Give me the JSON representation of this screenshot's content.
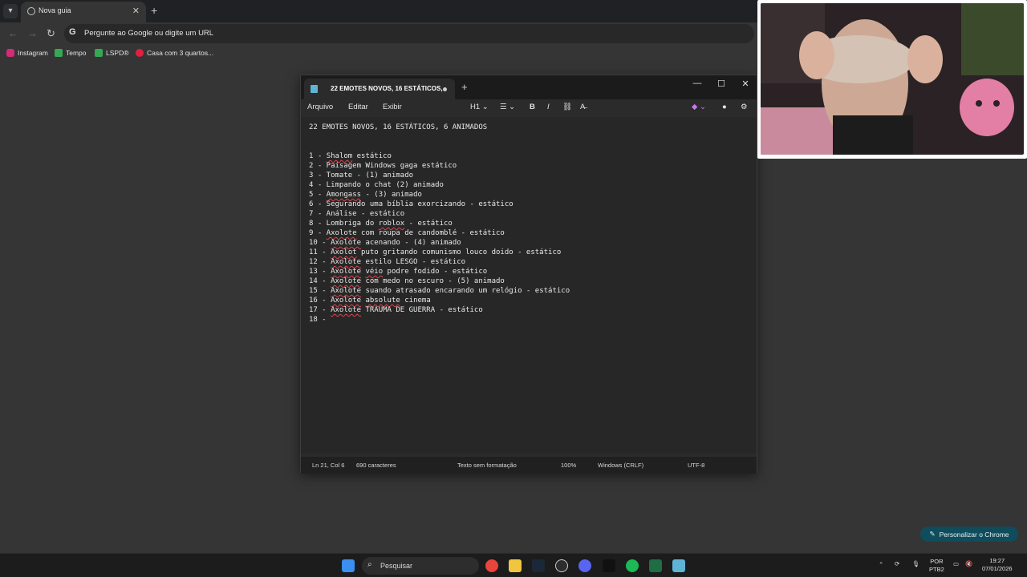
{
  "browser": {
    "tab_title": "Nova guia",
    "omnibox_placeholder": "Pergunte ao Google ou digite um URL",
    "bookmarks": [
      {
        "label": "Instagram",
        "color": "#d62976"
      },
      {
        "label": "Tempo",
        "color": "#34a853"
      },
      {
        "label": "LSPD®",
        "color": "#34a853"
      },
      {
        "label": "Casa com 3 quartos...",
        "color": "#e02040"
      }
    ],
    "customize_label": "Personalizar o Chrome"
  },
  "notepad": {
    "tab_title": "22 EMOTES NOVOS, 16 ESTÁTICOS,",
    "menu": [
      "Arquivo",
      "Editar",
      "Exibir"
    ],
    "heading_menu": "H1",
    "lines": [
      "22 EMOTES NOVOS, 16 ESTÁTICOS, 6 ANIMADOS",
      "",
      "",
      "1 - Shalom estático",
      "2 - Paisagem Windows gaga estático",
      "3 - Tomate - (1) animado",
      "4 - Limpando o chat (2) animado",
      "5 - Amongass - (3) animado",
      "6 - Segurando uma bíblia exorcizando - estático",
      "7 - Análise - estático",
      "8 - Lombriga do roblox - estático",
      "9 - Axolote com roupa de candomblé - estático",
      "10 - Axolote acenando - (4) animado",
      "11 - Axolot puto gritando comunismo louco doido - estático",
      "12 - Axolote estilo LESGO - estático",
      "13 - Axolote véio podre fodido - estático",
      "14 - Axolote com medo no escuro - (5) animado",
      "15 - Axolote suando atrasado encarando um relógio - estático",
      "16 - Axolote absolute cinema",
      "17 - Axolote TRAUMA DE GUERRA - estático",
      "18 - "
    ],
    "status": {
      "position": "Ln 21, Col 6",
      "chars": "690 caracteres",
      "format": "Texto sem formatação",
      "zoom": "100%",
      "line_ending": "Windows (CRLF)",
      "encoding": "UTF-8"
    }
  },
  "taskbar": {
    "search_label": "Pesquisar",
    "lang_top": "POR",
    "lang_bottom": "PTB2",
    "time": "19:27",
    "date": "07/01/2026"
  }
}
